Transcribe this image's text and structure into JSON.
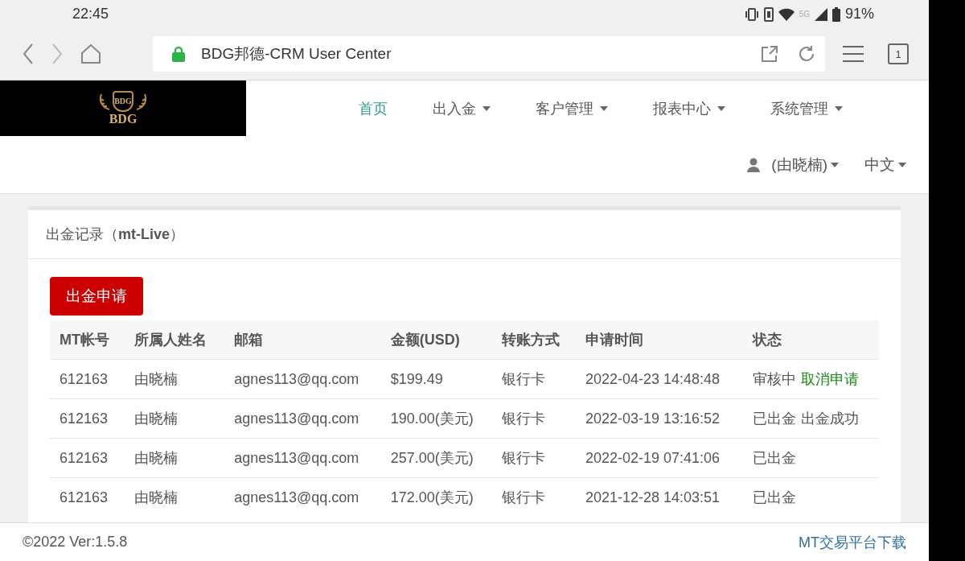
{
  "status_bar": {
    "time": "22:45",
    "network": "5G",
    "battery": "91%"
  },
  "browser": {
    "url_title": "BDG邦德-CRM User Center",
    "tab_count": "1"
  },
  "logo": {
    "badge_text": "BDG",
    "name": "BDG"
  },
  "nav": [
    {
      "label": "首页",
      "selected": true,
      "dropdown": false
    },
    {
      "label": "出入金",
      "selected": false,
      "dropdown": true
    },
    {
      "label": "客户管理",
      "selected": false,
      "dropdown": true
    },
    {
      "label": "报表中心",
      "selected": false,
      "dropdown": true
    },
    {
      "label": "系统管理",
      "selected": false,
      "dropdown": true
    }
  ],
  "user_menu": {
    "label": "(由晓楠)"
  },
  "language_menu": {
    "label": "中文"
  },
  "panel": {
    "title": "出金记录（**mt-Live**）",
    "button": "出金申请",
    "table": {
      "columns": [
        "MT帐号",
        "所属人姓名",
        "邮箱",
        "金额(USD)",
        "转账方式",
        "申请时间",
        "状态"
      ],
      "rows": [
        {
          "cells": [
            "612163",
            "由晓楠",
            "agnes113@qq.com",
            "$199.49",
            "银行卡",
            "2022-04-23 14:48:48"
          ],
          "status": [
            {
              "text": "审核中",
              "kind": "plain"
            },
            {
              "text": "取消申请",
              "kind": "link"
            }
          ]
        },
        {
          "cells": [
            "612163",
            "由晓楠",
            "agnes113@qq.com",
            "190.00(美元)",
            "银行卡",
            "2022-03-19 13:16:52"
          ],
          "status": [
            {
              "text": "已出金",
              "kind": "plain"
            },
            {
              "text": "出金成功",
              "kind": "plain"
            }
          ]
        },
        {
          "cells": [
            "612163",
            "由晓楠",
            "agnes113@qq.com",
            "257.00(美元)",
            "银行卡",
            "2022-02-19 07:41:06"
          ],
          "status": [
            {
              "text": "已出金",
              "kind": "plain"
            }
          ]
        },
        {
          "cells": [
            "612163",
            "由晓楠",
            "agnes113@qq.com",
            "172.00(美元)",
            "银行卡",
            "2021-12-28 14:03:51"
          ],
          "status": [
            {
              "text": "已出金",
              "kind": "plain"
            }
          ]
        }
      ]
    }
  },
  "footer": {
    "copyright": "©2022 Ver:1.5.8",
    "download_link": "MT交易平台下载"
  }
}
